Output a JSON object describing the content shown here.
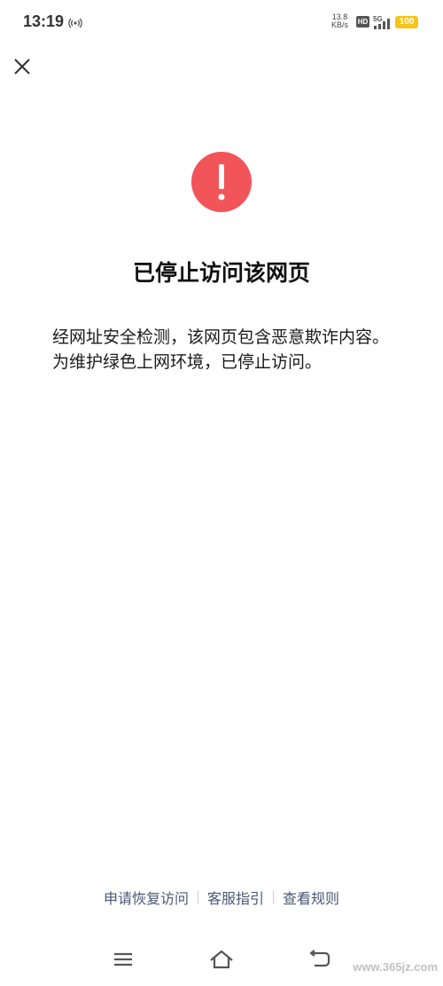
{
  "status_bar": {
    "time": "13:19",
    "speed_value": "13.8",
    "speed_unit": "KB/s",
    "hd_label": "HD",
    "network_label": "5G",
    "battery": "100",
    "icons": [
      "hotspot-icon",
      "signal-icon",
      "battery-icon"
    ]
  },
  "header": {
    "close_icon": "close-icon"
  },
  "main": {
    "icon": "warning-icon",
    "icon_color": "#f15459",
    "title": "已停止访问该网页",
    "description": "经网址安全检测，该网页包含恶意欺诈内容。为维护绿色上网环境，已停止访问。"
  },
  "footer": {
    "links": [
      "申请恢复访问",
      "客服指引",
      "查看规则"
    ],
    "link_color": "#4a5873"
  },
  "navbar": {
    "icons": [
      "menu-icon",
      "home-icon",
      "back-icon"
    ]
  },
  "watermark": "www.365jz.com"
}
